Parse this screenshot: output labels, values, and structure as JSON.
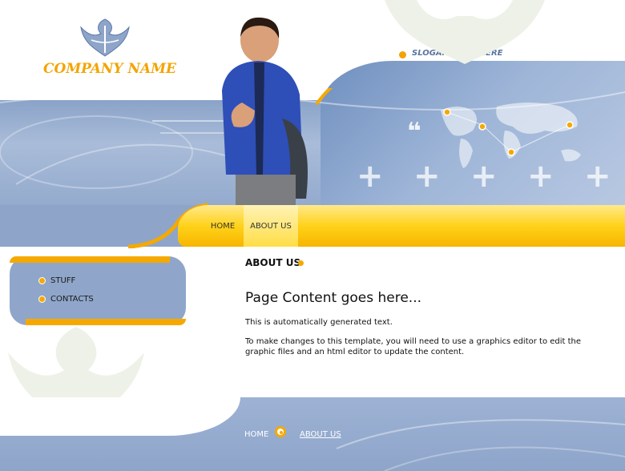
{
  "brand": {
    "company_name": "COMPANY NAME",
    "slogan": "SLOGAN GOES HERE"
  },
  "nav": {
    "items": [
      {
        "label": "HOME"
      },
      {
        "label": "ABOUT US"
      }
    ],
    "active": "ABOUT US"
  },
  "sidebar": {
    "items": [
      {
        "label": "STUFF"
      },
      {
        "label": "CONTACTS"
      }
    ]
  },
  "content": {
    "section_title": "ABOUT US",
    "heading": "Page Content goes here...",
    "paragraphs": [
      "This is automatically generated text.",
      "To make changes to this template, you will need to use a graphics editor to edit the graphic files and an html editor to update the content."
    ]
  },
  "footer": {
    "links": [
      {
        "label": "HOME"
      },
      {
        "label": "ABOUT US"
      }
    ]
  },
  "colors": {
    "accent": "#f5a900",
    "banner_blue": "#8ea5c9",
    "logo_orange": "#f3a400"
  },
  "icons": [
    "tribal-logo-icon",
    "world-map-icon",
    "plus-icon",
    "bullet-dot-icon",
    "quote-icon"
  ]
}
